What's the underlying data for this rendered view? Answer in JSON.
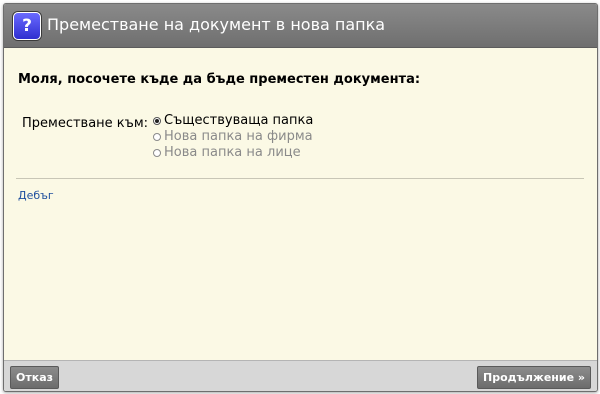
{
  "dialog": {
    "title": "Преместване на документ в нова папка",
    "help_icon_glyph": "?"
  },
  "content": {
    "prompt": "Моля, посочете къде да бъде преместен документа:",
    "move_label": "Преместване към:",
    "options": [
      {
        "label": "Съществуваща папка",
        "selected": true,
        "enabled": true
      },
      {
        "label": "Нова папка на фирма",
        "selected": false,
        "enabled": false
      },
      {
        "label": "Нова папка на лице",
        "selected": false,
        "enabled": false
      }
    ],
    "debug_link": "Дебъг"
  },
  "footer": {
    "cancel_label": "Отказ",
    "continue_label": "Продължение »"
  },
  "colors": {
    "background": "#fbf9e5",
    "titlebar": "#7a7a7a",
    "footer": "#d7d7d7",
    "link": "#1f4f9e",
    "button": "#7a7a7a",
    "help_icon": "#3c3cdf"
  }
}
